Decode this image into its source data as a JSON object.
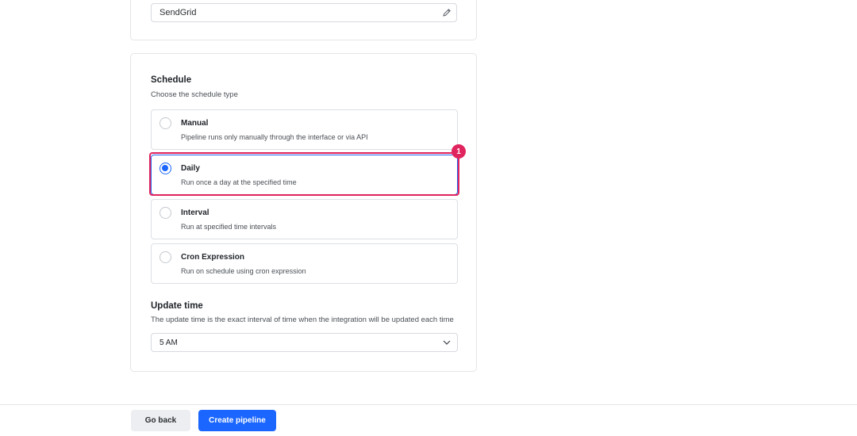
{
  "name_field": {
    "value": "SendGrid",
    "icon": "pencil-icon"
  },
  "schedule": {
    "title": "Schedule",
    "subtitle": "Choose the schedule type",
    "options": [
      {
        "label": "Manual",
        "description": "Pipeline runs only manually through the interface or via API",
        "selected": false
      },
      {
        "label": "Daily",
        "description": "Run once a day at the specified time",
        "selected": true
      },
      {
        "label": "Interval",
        "description": "Run at specified time intervals",
        "selected": false
      },
      {
        "label": "Cron Expression",
        "description": "Run on schedule using cron expression",
        "selected": false
      }
    ],
    "annotation_badge": "1"
  },
  "update_time": {
    "title": "Update time",
    "subtitle": "The update time is the exact interval of time when the integration will be updated each time",
    "selected_value": "5 AM",
    "icon": "chevron-down-icon"
  },
  "footer": {
    "back_label": "Go back",
    "create_label": "Create pipeline"
  },
  "colors": {
    "accent": "#1a66ff",
    "highlight": "#e0245e",
    "border": "#e3e5e8"
  }
}
